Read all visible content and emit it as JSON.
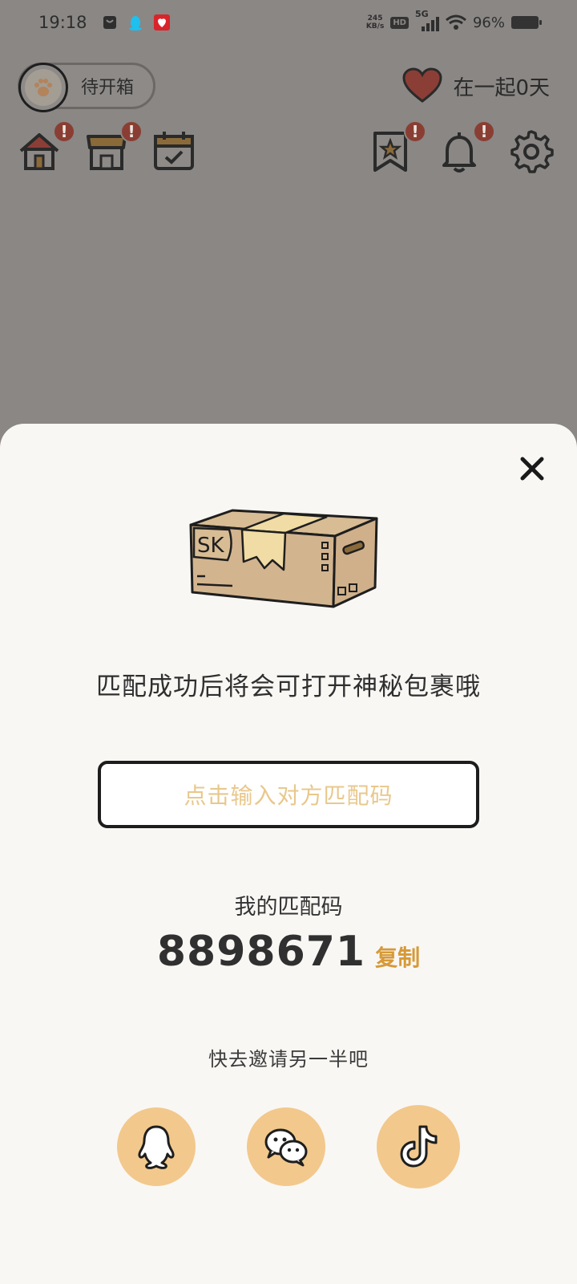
{
  "status_bar": {
    "time": "19:18",
    "net_speed": "245",
    "net_speed_unit": "KB/s",
    "hd": "HD",
    "network": "5G",
    "battery": "96%"
  },
  "header": {
    "pill_label": "待开箱",
    "together_text": "在一起0天"
  },
  "nav": {
    "badge": "!"
  },
  "sheet": {
    "hint": "匹配成功后将会可打开神秘包裹哦",
    "box_label": "SK",
    "input_placeholder": "点击输入对方匹配码",
    "my_code_label": "我的匹配码",
    "my_code": "8898671",
    "copy_label": "复制",
    "invite_text": "快去邀请另一半吧"
  },
  "colors": {
    "accent": "#d69a38",
    "placeholder": "#e8c88c",
    "share_button": "#f2c88c",
    "badge": "#8a3e33",
    "heart": "#8b3e36",
    "overlay": "#8a8785"
  },
  "icons": [
    "home-icon",
    "shop-icon",
    "calendar-icon",
    "bookmark-star-icon",
    "bell-icon",
    "gear-icon",
    "close-icon",
    "qq-icon",
    "wechat-icon",
    "tiktok-icon",
    "heart-icon",
    "paw-icon"
  ]
}
